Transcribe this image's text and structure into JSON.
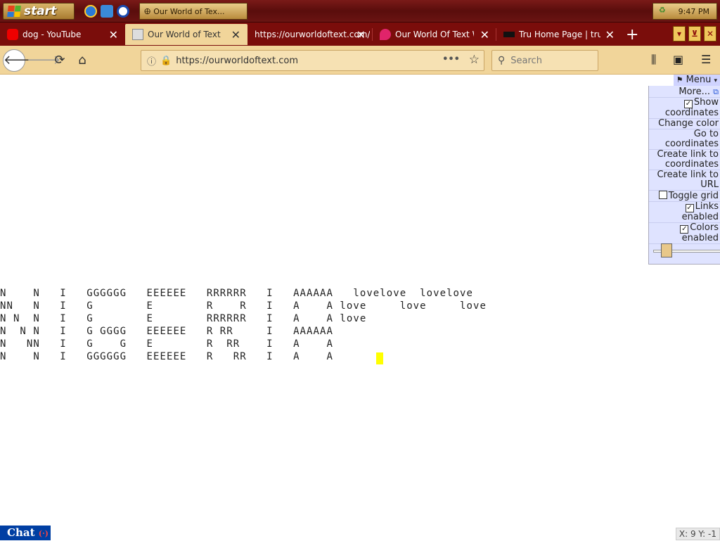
{
  "taskbar": {
    "start_label": "start",
    "active_task": "Our World of Tex...",
    "clock": "9:47 PM"
  },
  "tabs": [
    {
      "label": "dog - YouTube",
      "icon": "youtube-icon"
    },
    {
      "label": "Our World of Text",
      "icon": "owot-icon"
    },
    {
      "label": "https://ourworldoftext.com/",
      "icon": ""
    },
    {
      "label": "Our World Of Text Wiki",
      "icon": "wiki-icon"
    },
    {
      "label": "Tru Home Page | truTV.c",
      "icon": "trutv-icon"
    }
  ],
  "nav": {
    "url": "https://ourworldoftext.com",
    "search_placeholder": "Search"
  },
  "owot_menu": {
    "menu_label": "Menu",
    "items": [
      {
        "label": "More...",
        "checkbox": null
      },
      {
        "label": "Show coordinates",
        "checkbox": true
      },
      {
        "label": "Change color",
        "checkbox": null
      },
      {
        "label": "Go to coordinates",
        "checkbox": null
      },
      {
        "label": "Create link to coordinates",
        "checkbox": null
      },
      {
        "label": "Create link to URL",
        "checkbox": null
      },
      {
        "label": "Toggle grid",
        "checkbox": false
      },
      {
        "label": "Links enabled",
        "checkbox": true
      },
      {
        "label": "Colors enabled",
        "checkbox": true
      }
    ]
  },
  "world_text": [
    "N    N   I   GGGGGG   EEEEEE   RRRRRR   I   AAAAAA   lovelove  lovelove",
    "NN   N   I   G        E        R    R   I   A    A love     love     love",
    "N N  N   I   G        E        RRRRRR   I   A    A love",
    "N  N N   I   G GGGG   EEEEEE   R RR     I   AAAAAA",
    "N   NN   I   G    G   E        R  RR    I   A    A",
    "N    N   I   GGGGGG   EEEEEE   R   RR   I   A    A"
  ],
  "chat_label": "Chat",
  "coordinates": "X: 9 Y: -1"
}
